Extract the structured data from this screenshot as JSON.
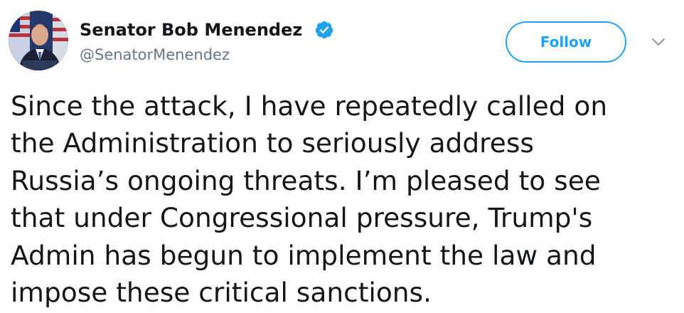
{
  "author": {
    "display_name": "Senator Bob Menendez",
    "handle": "@SenatorMenendez",
    "verified": true,
    "avatar_icon": "profile-photo"
  },
  "actions": {
    "follow_label": "Follow",
    "more_icon": "chevron-down-icon"
  },
  "tweet": {
    "lines": [
      "Since the attack, I have repeatedly called on",
      "the Administration to seriously address",
      "Russia’s ongoing threats. I’m pleased to see",
      "that under Congressional pressure, Trump's",
      "Admin has begun to implement the law and",
      "impose these critical sanctions."
    ]
  },
  "colors": {
    "accent": "#1da1f2",
    "text": "#14171a",
    "secondary_text": "#657786",
    "background": "#ffffff"
  }
}
